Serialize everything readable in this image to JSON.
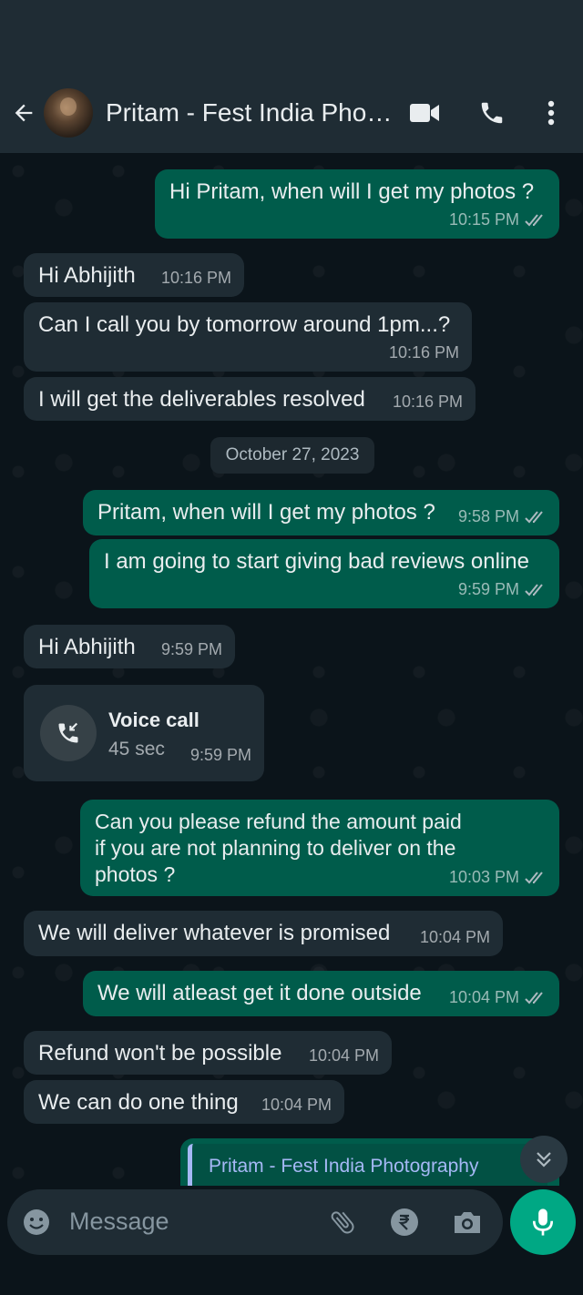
{
  "header": {
    "contact_name": "Pritam - Fest India Photography",
    "icons": [
      "back-arrow-icon",
      "video-call-icon",
      "phone-icon",
      "more-options-icon"
    ]
  },
  "messages": [
    {
      "direction": "out",
      "text": "Hi Pritam, when will I get my photos ?",
      "time": "10:15 PM",
      "status": "read"
    },
    {
      "direction": "in",
      "text": "Hi Abhijith",
      "time": "10:16 PM"
    },
    {
      "direction": "in",
      "text": "Can I call you by tomorrow around 1pm...?",
      "time": "10:16 PM"
    },
    {
      "direction": "in",
      "text": "I will get the deliverables resolved",
      "time": "10:16 PM"
    },
    {
      "direction": "out",
      "text": "Pritam, when will I get my photos ?",
      "time": "9:58 PM",
      "status": "read"
    },
    {
      "direction": "out",
      "text": "I am going to start giving bad reviews online",
      "time": "9:59 PM",
      "status": "read"
    },
    {
      "direction": "in",
      "text": "Hi Abhijith",
      "time": "9:59 PM"
    },
    {
      "direction": "out",
      "text": "Can you please refund the amount paid if you are not planning to deliver on the photos ?",
      "time": "10:03 PM",
      "status": "read"
    },
    {
      "direction": "in",
      "text": "We will deliver whatever is promised",
      "time": "10:04 PM"
    },
    {
      "direction": "out",
      "text": "We will atleast get it done outside",
      "time": "10:04 PM",
      "status": "read"
    },
    {
      "direction": "in",
      "text": "Refund won't be possible",
      "time": "10:04 PM"
    },
    {
      "direction": "in",
      "text": "We can do one thing",
      "time": "10:04 PM"
    }
  ],
  "date_separator": "October 27, 2023",
  "voice_call": {
    "label": "Voice call",
    "duration": "45 sec",
    "time": "9:59 PM"
  },
  "quoted_reply": {
    "sender": "Pritam - Fest India Photography"
  },
  "composer": {
    "placeholder": "Message"
  },
  "colors": {
    "background": "#0b141a",
    "header": "#1f2c34",
    "outgoing_bubble": "#005c4b",
    "incoming_bubble": "#1f2c34",
    "accent": "#00a884"
  }
}
